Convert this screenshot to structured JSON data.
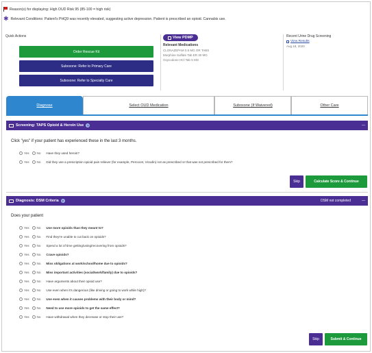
{
  "banners": {
    "reason": "Reason(s) for displaying: High OUD Risk 95 (85-100 = high risk)",
    "conditions": "Relevant Conditions: Patient's PHQ9 was recently elevated, suggesting active depression. Patient is prescribed an opioid. Cannabis use."
  },
  "quick_actions": {
    "title": "Quick Actions",
    "buttons": [
      "Order Rescue Kit",
      "Suboxone: Refer to Primary Care",
      "Suboxone: Refer to Specialty Care"
    ]
  },
  "medications": {
    "pdmp_label": "View PDMP",
    "title": "Relevant Medications",
    "items": [
      "CLONAZEPAM 0.5 MG OR TABS",
      "Morphine Sulfate Tab ER 30 MG",
      "Oxycodone HCl Tab 5 MG"
    ]
  },
  "drug_screening": {
    "title": "Recent Urine Drug Screening",
    "link": "View Results",
    "date": "Aug 18, 2020"
  },
  "tabs": [
    {
      "label": "Diagnose"
    },
    {
      "label": "Select OUD Medication"
    },
    {
      "label": "Suboxone (If Waivered)"
    },
    {
      "label": "Other Care"
    }
  ],
  "screening": {
    "header": "Screening: TAPS Opioid & Heroin Use",
    "collapse": "—",
    "prompt": "Click \"yes\" if your patient has experienced these in the last 3 months.",
    "yes": "Yes",
    "no": "No",
    "questions": [
      "Have they used heroin?",
      "Did they use a prescription opioid pain reliever (for example, Percocet, Vicodin) not as prescribed or that was not prescribed for them?"
    ],
    "skip": "Skip",
    "submit": "Calculate Score & Continue"
  },
  "diagnosis": {
    "header": "Diagnosis: DSM Criteria",
    "status": "DSM not completed",
    "collapse": "—",
    "prompt": "Does your patient",
    "yes": "Yes",
    "no": "No",
    "questions": [
      "Use more opioids than they meant to?",
      "Find they're unable to cut back on opioids?",
      "Spend a lot of time getting/using/recovering from opioids?",
      "Crave opioids?",
      "Miss obligations at work/school/home due to opioids?",
      "Miss important activities (social/work/family) due to opioids?",
      "Have arguments about their opioid use?",
      "Use even when it's dangerous (like driving or going to work while high)?",
      "Use even when it causes problems with their body or mind?",
      "Need to use more opioids to get the same effect?",
      "Have withdrawal when they decrease or stop their use?"
    ],
    "skip": "Skip",
    "submit": "Submit & Continue"
  },
  "colors": {
    "purple": "#4b2e94",
    "navy": "#2d2d86",
    "green": "#1d9a3c",
    "tab_blue": "#2e86cf",
    "flag_red": "#d21b1b"
  }
}
